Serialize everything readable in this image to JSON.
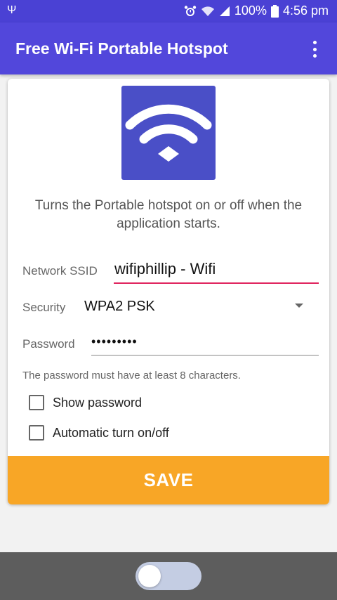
{
  "status_bar": {
    "usb_icon": "usb-icon",
    "battery_percent": "100%",
    "time": "4:56 pm",
    "icons": [
      "alarm-icon",
      "wifi-icon",
      "signal-icon",
      "battery-icon"
    ]
  },
  "app_bar": {
    "title": "Free Wi-Fi Portable Hotspot",
    "overflow_icon": "more-vert-icon",
    "color": "#5247db"
  },
  "card": {
    "logo_icon": "wifi-icon",
    "description": "Turns the Portable hotspot on or off when the application starts.",
    "ssid": {
      "label": "Network SSID",
      "value": "wifiphillip - Wifi"
    },
    "security": {
      "label": "Security",
      "value": "WPA2 PSK"
    },
    "password": {
      "label": "Password",
      "value": "•••••••••"
    },
    "hint": "The password must have at least 8 characters.",
    "show_password": {
      "label": "Show password",
      "checked": false
    },
    "auto_toggle": {
      "label": "Automatic turn on/off",
      "checked": false
    },
    "save_label": "SAVE",
    "save_color": "#f8a626"
  },
  "bottom_bar": {
    "toggle_on": false
  }
}
